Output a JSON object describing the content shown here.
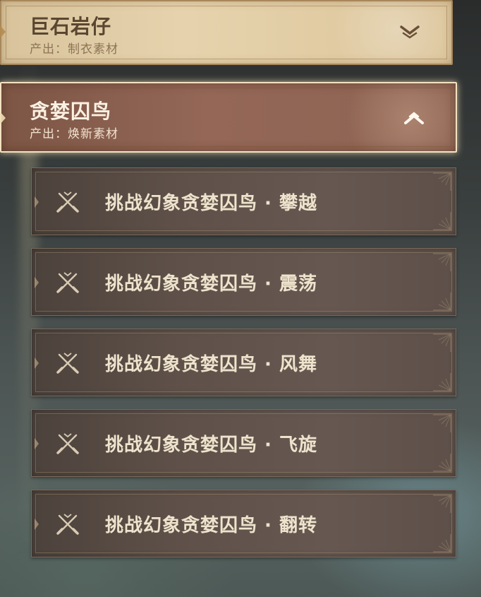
{
  "categories": [
    {
      "title": "巨石岩仔",
      "subtitle": "产出：制衣素材",
      "expanded": false,
      "chevron": "chevron-down-icon"
    },
    {
      "title": "贪婪囚鸟",
      "subtitle": "产出：焕新素材",
      "expanded": true,
      "chevron": "chevron-up-icon"
    }
  ],
  "challenges": [
    {
      "label": "挑战幻象贪婪囚鸟 · 攀越",
      "icon": "crossed-swords-icon"
    },
    {
      "label": "挑战幻象贪婪囚鸟 · 震荡",
      "icon": "crossed-swords-icon"
    },
    {
      "label": "挑战幻象贪婪囚鸟 · 风舞",
      "icon": "crossed-swords-icon"
    },
    {
      "label": "挑战幻象贪婪囚鸟 · 飞旋",
      "icon": "crossed-swords-icon"
    },
    {
      "label": "挑战幻象贪婪囚鸟 · 翻转",
      "icon": "crossed-swords-icon"
    }
  ],
  "colors": {
    "selected_border": "#f4e2c0",
    "row_text": "#eee3cc",
    "header_text_dark": "#5a4630"
  }
}
